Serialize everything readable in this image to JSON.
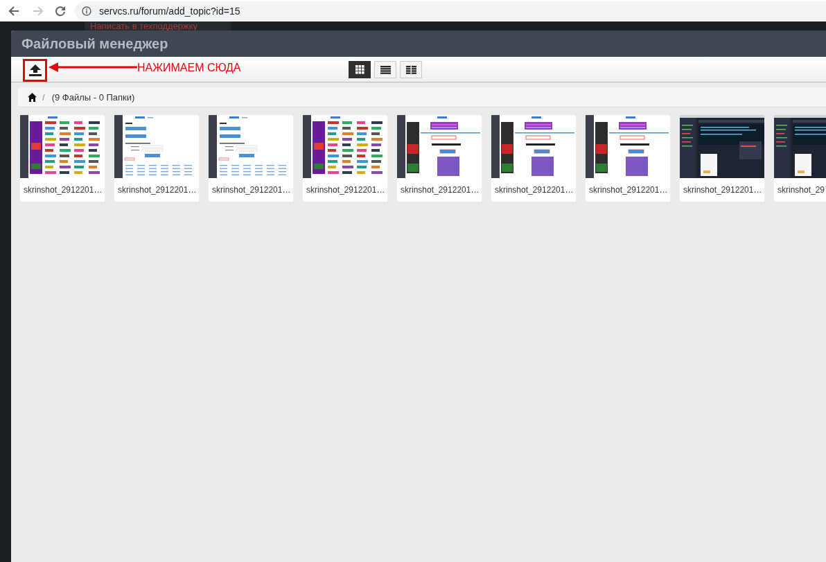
{
  "browser": {
    "back": {
      "disabled": false
    },
    "forward": {
      "disabled": true
    },
    "url": "servcs.ru/forum/add_topic?id=15"
  },
  "background_page": {
    "link": "Написать в техподдержку"
  },
  "window": {
    "title": "Файловый менеджер"
  },
  "toolbar": {
    "view_buttons": [
      {
        "kind": "grid",
        "selected": true
      },
      {
        "kind": "list",
        "selected": false
      },
      {
        "kind": "details",
        "selected": false
      }
    ]
  },
  "annotation": {
    "text": "НАЖИМАЕМ СЮДА"
  },
  "breadcrumb": {
    "separator": "/",
    "summary": "(9 Файлы - 0 Папки)"
  },
  "files": [
    {
      "name": "skrinshot_2912201…",
      "kind": "text-styles"
    },
    {
      "name": "skrinshot_2912201…",
      "kind": "login-form"
    },
    {
      "name": "skrinshot_2912201…",
      "kind": "login-form"
    },
    {
      "name": "skrinshot_2912201…",
      "kind": "text-styles"
    },
    {
      "name": "skrinshot_2912201…",
      "kind": "generator"
    },
    {
      "name": "skrinshot_2912201…",
      "kind": "generator"
    },
    {
      "name": "skrinshot_2912201…",
      "kind": "generator"
    },
    {
      "name": "skrinshot_2912201…",
      "kind": "editor"
    },
    {
      "name": "skrinshot_29",
      "kind": "editor"
    }
  ]
}
